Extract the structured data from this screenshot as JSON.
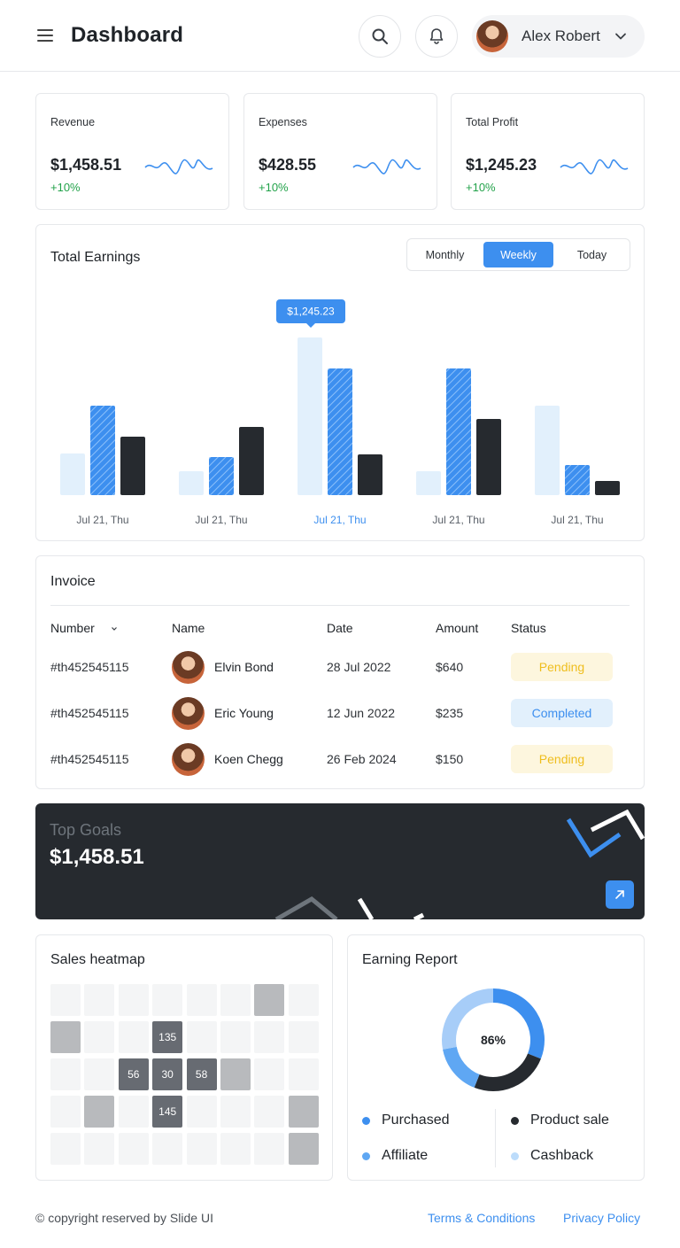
{
  "header": {
    "title": "Dashboard",
    "user_name": "Alex Robert"
  },
  "stats": [
    {
      "label": "Revenue",
      "value": "$1,458.51",
      "change": "+10%"
    },
    {
      "label": "Expenses",
      "value": "$428.55",
      "change": "+10%"
    },
    {
      "label": "Total Profit",
      "value": "$1,245.23",
      "change": "+10%"
    }
  ],
  "earnings": {
    "title": "Total Earnings",
    "tabs": [
      "Monthly",
      "Weekly",
      "Today"
    ],
    "active_tab": "Weekly",
    "tooltip": "$1,245.23"
  },
  "chart_data": {
    "type": "bar",
    "title": "Total Earnings",
    "categories": [
      "Jul 21, Thu",
      "Jul 21, Thu",
      "Jul 21, Thu",
      "Jul 21, Thu",
      "Jul 21, Thu"
    ],
    "highlighted_category_index": 2,
    "series": [
      {
        "values": [
          47,
          27,
          178,
          27,
          101
        ],
        "color": "#e2f0fc"
      },
      {
        "values": [
          101,
          43,
          143,
          143,
          34
        ],
        "color": "#3d8fef"
      },
      {
        "values": [
          66,
          77,
          46,
          86,
          16
        ],
        "color": "#262a2f"
      }
    ],
    "ylim": [
      0,
      190
    ],
    "grid": false
  },
  "invoice": {
    "title": "Invoice",
    "columns": [
      "Number",
      "Name",
      "Date",
      "Amount",
      "Status"
    ],
    "rows": [
      {
        "number": "#th452545115",
        "name": "Elvin Bond",
        "date": "28 Jul 2022",
        "amount": "$640",
        "status": "Pending"
      },
      {
        "number": "#th452545115",
        "name": "Eric Young",
        "date": "12 Jun 2022",
        "amount": "$235",
        "status": "Completed"
      },
      {
        "number": "#th452545115",
        "name": "Koen Chegg",
        "date": "26 Feb 2024",
        "amount": "$150",
        "status": "Pending"
      }
    ]
  },
  "goals": {
    "label": "Top Goals",
    "value": "$1,458.51"
  },
  "heatmap": {
    "title": "Sales heatmap",
    "grid": [
      [
        0,
        0,
        0,
        0,
        0,
        0,
        1,
        0
      ],
      [
        1,
        0,
        0,
        2,
        0,
        0,
        0,
        0
      ],
      [
        0,
        0,
        2,
        2,
        2,
        1,
        0,
        0
      ],
      [
        0,
        1,
        0,
        2,
        0,
        0,
        0,
        1
      ],
      [
        0,
        0,
        0,
        0,
        0,
        0,
        0,
        1
      ]
    ],
    "labels": [
      [
        "",
        "",
        "",
        "",
        "",
        "",
        "",
        ""
      ],
      [
        "",
        "",
        "",
        "135",
        "",
        "",
        "",
        ""
      ],
      [
        "",
        "",
        "56",
        "30",
        "58",
        "",
        "",
        ""
      ],
      [
        "",
        "",
        "",
        "145",
        "",
        "",
        "",
        ""
      ],
      [
        "",
        "",
        "",
        "",
        "",
        "",
        "",
        ""
      ]
    ]
  },
  "report": {
    "title": "Earning Report",
    "center_label": "86%",
    "segments": [
      {
        "value": 31,
        "color": "#3d8fef"
      },
      {
        "value": 25,
        "color": "#262a2f"
      },
      {
        "value": 16,
        "color": "#5fa7f3"
      },
      {
        "value": 28,
        "color": "#a7cdf8"
      }
    ],
    "legend": [
      {
        "label": "Purchased",
        "color": "#3d8fef"
      },
      {
        "label": "Product sale",
        "color": "#262a2f"
      },
      {
        "label": "Affiliate",
        "color": "#5fa7f3"
      },
      {
        "label": "Cashback",
        "color": "#bcdcfb"
      }
    ]
  },
  "footer": {
    "copyright": "© copyright reserved by Slide UI",
    "terms": "Terms & Conditions",
    "privacy": "Privacy Policy"
  }
}
